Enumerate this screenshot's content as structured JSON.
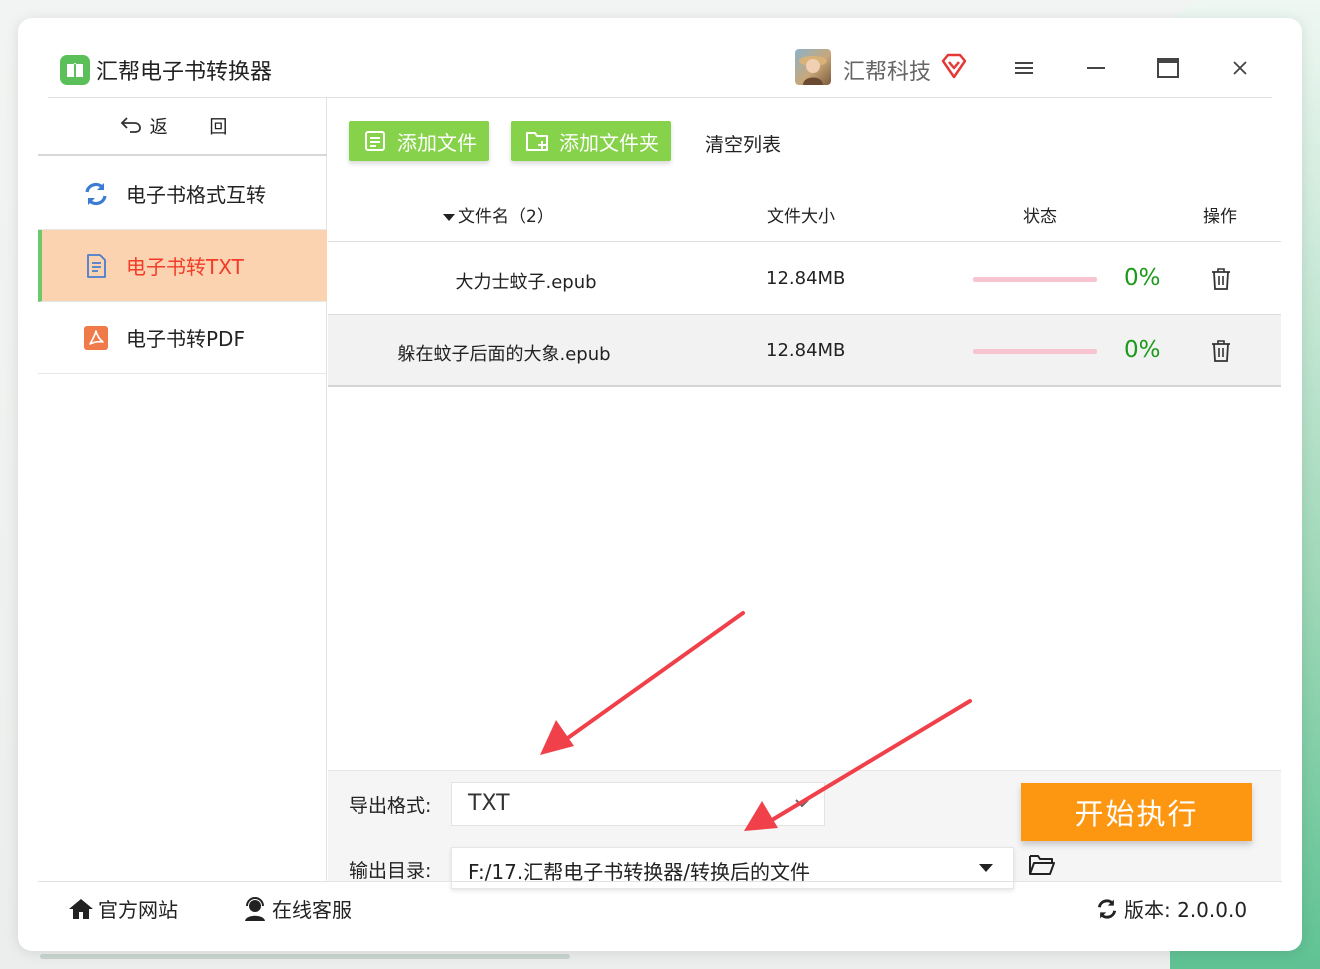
{
  "window": {
    "app_title": "汇帮电子书转换器",
    "company": "汇帮科技"
  },
  "sidebar": {
    "back_label": "返 回",
    "items": [
      {
        "label": "电子书格式互转",
        "icon": "refresh-icon"
      },
      {
        "label": "电子书转TXT",
        "icon": "document-icon",
        "active": true
      },
      {
        "label": "电子书转PDF",
        "icon": "pdf-icon"
      }
    ]
  },
  "toolbar": {
    "add_file_label": "添加文件",
    "add_folder_label": "添加文件夹",
    "clear_label": "清空列表"
  },
  "table": {
    "headers": {
      "name": "文件名（2）",
      "size": "文件大小",
      "status": "状态",
      "op": "操作"
    },
    "rows": [
      {
        "name": "大力士蚊子.epub",
        "size": "12.84MB",
        "progress_pct": "0%",
        "progress": 0
      },
      {
        "name": "躲在蚊子后面的大象.epub",
        "size": "12.84MB",
        "progress_pct": "0%",
        "progress": 0
      }
    ]
  },
  "output": {
    "format_label": "导出格式:",
    "format_value": "TXT",
    "dir_label": "输出目录:",
    "dir_value": "F:/17.汇帮电子书转换器/转换后的文件",
    "start_label": "开始执行"
  },
  "footer": {
    "site_label": "官方网站",
    "service_label": "在线客服",
    "version_label": "版本: 2.0.0.0"
  },
  "colors": {
    "accent_green": "#86d24a",
    "active_nav_bg": "#fcd3b0",
    "active_nav_text": "#f23b28",
    "start_button": "#fd9611",
    "progress_pct_text": "#1a9a1a",
    "progress_track": "#f7c4cf",
    "annotation_arrow": "#f0404a"
  }
}
